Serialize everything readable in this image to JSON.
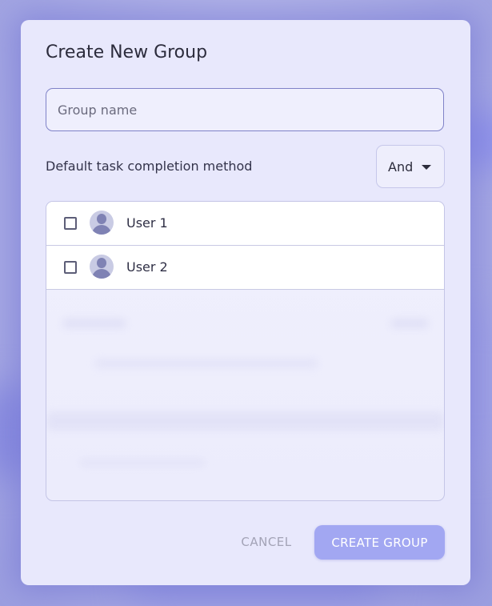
{
  "dialog": {
    "title": "Create New Group",
    "name_field": {
      "placeholder": "Group name",
      "value": ""
    },
    "method": {
      "label": "Default task completion method",
      "selected": "And"
    },
    "users": [
      {
        "name": "User 1",
        "checked": false
      },
      {
        "name": "User 2",
        "checked": false
      }
    ],
    "buttons": {
      "cancel": "CANCEL",
      "create": "CREATE GROUP"
    }
  },
  "colors": {
    "accent": "#a2a7f2",
    "dialog_bg": "#e8e8fc",
    "field_border": "#7f82c8"
  }
}
